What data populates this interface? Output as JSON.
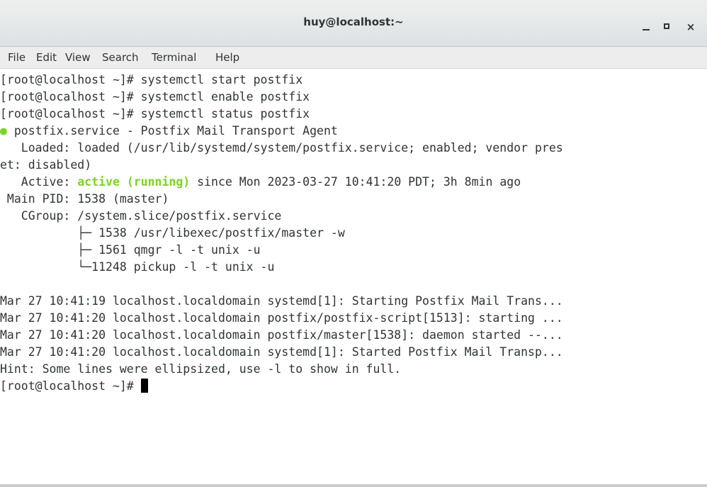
{
  "window": {
    "title": "huy@localhost:~",
    "controls": {
      "minimize": "",
      "maximize": "",
      "close": "×"
    }
  },
  "menu": {
    "items": [
      "File",
      "Edit",
      "View",
      "Search",
      "Terminal",
      "Help"
    ]
  },
  "terminal": {
    "colors": {
      "active": "#7ed321",
      "bullet": "#7ed321",
      "text": "#2e3436",
      "background": "#ffffff"
    },
    "lines": [
      "[root@localhost ~]# systemctl start postfix",
      "[root@localhost ~]# systemctl enable postfix",
      "[root@localhost ~]# systemctl status postfix",
      " postfix.service - Postfix Mail Transport Agent",
      "   Loaded: loaded (/usr/lib/systemd/system/postfix.service; enabled; vendor pres",
      "et: disabled)",
      "   Active: ",
      " Main PID: 1538 (master)",
      "   CGroup: /system.slice/postfix.service",
      "           ├─ 1538 /usr/libexec/postfix/master -w",
      "           ├─ 1561 qmgr -l -t unix -u",
      "           └─11248 pickup -l -t unix -u",
      "",
      "Mar 27 10:41:19 localhost.localdomain systemd[1]: Starting Postfix Mail Trans...",
      "Mar 27 10:41:20 localhost.localdomain postfix/postfix-script[1513]: starting ...",
      "Mar 27 10:41:20 localhost.localdomain postfix/master[1538]: daemon started --...",
      "Mar 27 10:41:20 localhost.localdomain systemd[1]: Started Postfix Mail Transp...",
      "Hint: Some lines were ellipsized, use -l to show in full.",
      "[root@localhost ~]# "
    ],
    "bullet": "●",
    "active_status": "active (running)",
    "active_rest": " since Mon 2023-03-27 10:41:20 PDT; 3h 8min ago"
  }
}
